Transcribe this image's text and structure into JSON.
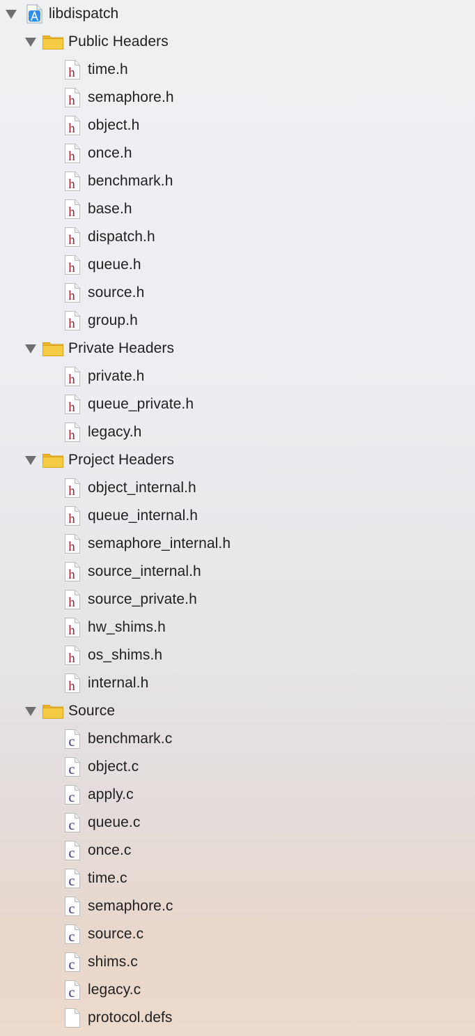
{
  "project": {
    "name": "libdispatch",
    "icon": "xcode-project-icon"
  },
  "groups": [
    {
      "name": "Public Headers",
      "files": [
        {
          "name": "time.h",
          "kind": "h"
        },
        {
          "name": "semaphore.h",
          "kind": "h"
        },
        {
          "name": "object.h",
          "kind": "h"
        },
        {
          "name": "once.h",
          "kind": "h"
        },
        {
          "name": "benchmark.h",
          "kind": "h"
        },
        {
          "name": "base.h",
          "kind": "h"
        },
        {
          "name": "dispatch.h",
          "kind": "h"
        },
        {
          "name": "queue.h",
          "kind": "h"
        },
        {
          "name": "source.h",
          "kind": "h"
        },
        {
          "name": "group.h",
          "kind": "h"
        }
      ]
    },
    {
      "name": "Private Headers",
      "files": [
        {
          "name": "private.h",
          "kind": "h"
        },
        {
          "name": "queue_private.h",
          "kind": "h"
        },
        {
          "name": "legacy.h",
          "kind": "h"
        }
      ]
    },
    {
      "name": "Project Headers",
      "files": [
        {
          "name": "object_internal.h",
          "kind": "h"
        },
        {
          "name": "queue_internal.h",
          "kind": "h"
        },
        {
          "name": "semaphore_internal.h",
          "kind": "h"
        },
        {
          "name": "source_internal.h",
          "kind": "h"
        },
        {
          "name": "source_private.h",
          "kind": "h"
        },
        {
          "name": "hw_shims.h",
          "kind": "h"
        },
        {
          "name": "os_shims.h",
          "kind": "h"
        },
        {
          "name": "internal.h",
          "kind": "h"
        }
      ]
    },
    {
      "name": "Source",
      "files": [
        {
          "name": "benchmark.c",
          "kind": "c"
        },
        {
          "name": "object.c",
          "kind": "c"
        },
        {
          "name": "apply.c",
          "kind": "c"
        },
        {
          "name": "queue.c",
          "kind": "c"
        },
        {
          "name": "once.c",
          "kind": "c"
        },
        {
          "name": "time.c",
          "kind": "c"
        },
        {
          "name": "semaphore.c",
          "kind": "c"
        },
        {
          "name": "source.c",
          "kind": "c"
        },
        {
          "name": "shims.c",
          "kind": "c"
        },
        {
          "name": "legacy.c",
          "kind": "c"
        },
        {
          "name": "protocol.defs",
          "kind": "plain"
        }
      ]
    }
  ],
  "colors": {
    "header_glyph": "#9b1b30",
    "source_glyph": "#3c2f7a",
    "folder_fill": "#f7cc45",
    "folder_stroke": "#d9a21b",
    "disclosure": "#6f6f6f"
  }
}
